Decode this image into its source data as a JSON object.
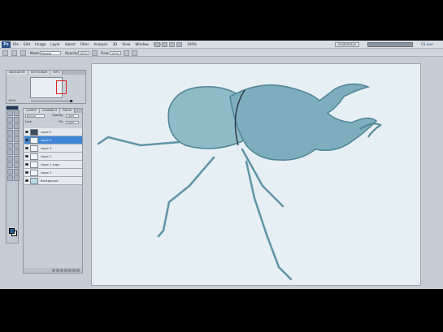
{
  "app": {
    "logo_text": "Ps",
    "menu": [
      "File",
      "Edit",
      "Image",
      "Layer",
      "Select",
      "Filter",
      "Analysis",
      "3D",
      "View",
      "Window",
      "Help"
    ],
    "zoom": "100%",
    "workspace": "ESSENTIALS",
    "search_placeholder": "",
    "cs_live": "CS Live"
  },
  "options_bar": {
    "mode_label": "Mode:",
    "mode_value": "Normal",
    "opacity_label": "Opacity:",
    "opacity_value": "100%",
    "flow_label": "Flow:",
    "flow_value": "100%"
  },
  "navigator": {
    "tabs": [
      "NAVIGATOR",
      "HISTOGRAM",
      "INFO"
    ],
    "zoom_text": "100%"
  },
  "layers": {
    "tabs": [
      "LAYERS",
      "CHANNELS",
      "PATHS"
    ],
    "blend_mode": "Normal",
    "opacity_label": "Opacity:",
    "opacity_value": "100%",
    "lock_label": "Lock:",
    "fill_label": "Fill:",
    "fill_value": "100%",
    "items": [
      {
        "name": "Layer 5",
        "thumb": "dark",
        "selected": false
      },
      {
        "name": "Layer 4",
        "thumb": "light",
        "selected": true
      },
      {
        "name": "Layer 3",
        "thumb": "light",
        "selected": false
      },
      {
        "name": "Layer 2",
        "thumb": "light",
        "selected": false
      },
      {
        "name": "Layer 1 copy",
        "thumb": "light",
        "selected": false
      },
      {
        "name": "Layer 1",
        "thumb": "light",
        "selected": false
      },
      {
        "name": "Background",
        "thumb": "img",
        "selected": false
      }
    ]
  },
  "colors": {
    "foreground": "#1d5a8c",
    "background": "#ffffff",
    "canvas_bg": "#e6eff4",
    "beetle": "#7eaebd"
  }
}
